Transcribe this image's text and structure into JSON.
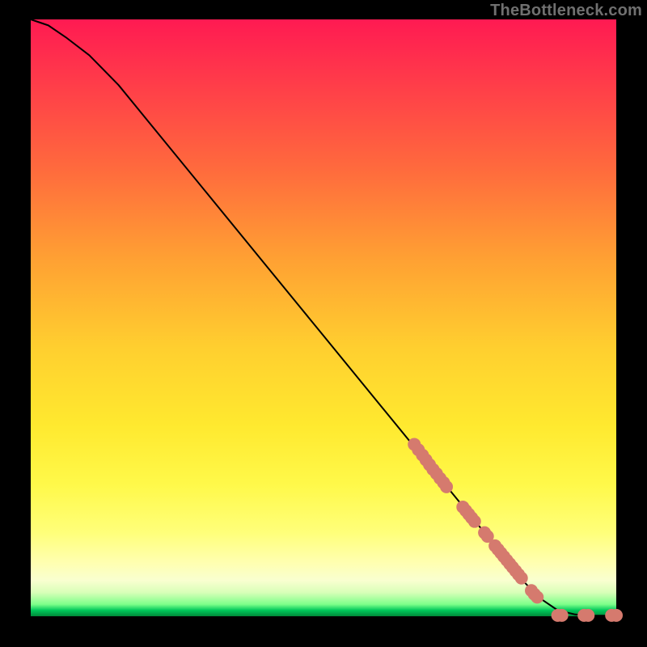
{
  "watermark": "TheBottleneck.com",
  "chart_data": {
    "type": "line",
    "title": "",
    "xlabel": "",
    "ylabel": "",
    "xlim": [
      0,
      100
    ],
    "ylim": [
      0,
      100
    ],
    "grid": false,
    "legend": false,
    "series": [
      {
        "name": "bottleneck-curve",
        "color": "#000000",
        "x": [
          0,
          3,
          6,
          10,
          15,
          20,
          30,
          40,
          50,
          60,
          65,
          70,
          75,
          80,
          84,
          87,
          90,
          93,
          96,
          100
        ],
        "y": [
          100,
          99,
          97,
          94,
          89,
          83,
          71,
          59,
          47,
          35,
          29,
          23,
          17,
          11,
          6,
          3,
          1,
          0.3,
          0.1,
          0.1
        ]
      }
    ],
    "points": [
      {
        "name": "marker-cluster-1",
        "color": "#d57a6e",
        "r": 8,
        "data": [
          [
            65.5,
            28.8
          ],
          [
            66.2,
            27.9
          ],
          [
            66.9,
            27.0
          ],
          [
            67.5,
            26.2
          ],
          [
            68.1,
            25.4
          ],
          [
            68.7,
            24.6
          ],
          [
            69.3,
            23.9
          ],
          [
            69.9,
            23.1
          ],
          [
            70.5,
            22.4
          ],
          [
            71.0,
            21.7
          ]
        ]
      },
      {
        "name": "marker-cluster-2",
        "color": "#d57a6e",
        "r": 8,
        "data": [
          [
            73.8,
            18.3
          ],
          [
            74.3,
            17.7
          ],
          [
            74.8,
            17.1
          ],
          [
            75.3,
            16.5
          ],
          [
            75.8,
            15.9
          ]
        ]
      },
      {
        "name": "marker-cluster-3",
        "color": "#d57a6e",
        "r": 8,
        "data": [
          [
            77.5,
            14.0
          ],
          [
            78.0,
            13.4
          ]
        ]
      },
      {
        "name": "marker-cluster-4",
        "color": "#d57a6e",
        "r": 8,
        "data": [
          [
            79.3,
            11.8
          ],
          [
            79.8,
            11.2
          ],
          [
            80.3,
            10.6
          ],
          [
            80.8,
            10.0
          ],
          [
            81.3,
            9.4
          ],
          [
            81.8,
            8.8
          ],
          [
            82.3,
            8.2
          ],
          [
            82.8,
            7.6
          ],
          [
            83.3,
            7.0
          ],
          [
            83.8,
            6.4
          ]
        ]
      },
      {
        "name": "marker-cluster-5",
        "color": "#d57a6e",
        "r": 8,
        "data": [
          [
            85.5,
            4.3
          ],
          [
            86.0,
            3.7
          ],
          [
            86.5,
            3.2
          ]
        ]
      },
      {
        "name": "marker-flat-1",
        "color": "#d57a6e",
        "r": 8,
        "data": [
          [
            90.0,
            0.15
          ],
          [
            90.7,
            0.15
          ]
        ]
      },
      {
        "name": "marker-flat-2",
        "color": "#d57a6e",
        "r": 8,
        "data": [
          [
            94.5,
            0.15
          ],
          [
            95.2,
            0.15
          ]
        ]
      },
      {
        "name": "marker-flat-3",
        "color": "#d57a6e",
        "r": 8,
        "data": [
          [
            99.2,
            0.15
          ],
          [
            100.0,
            0.15
          ]
        ]
      }
    ]
  }
}
